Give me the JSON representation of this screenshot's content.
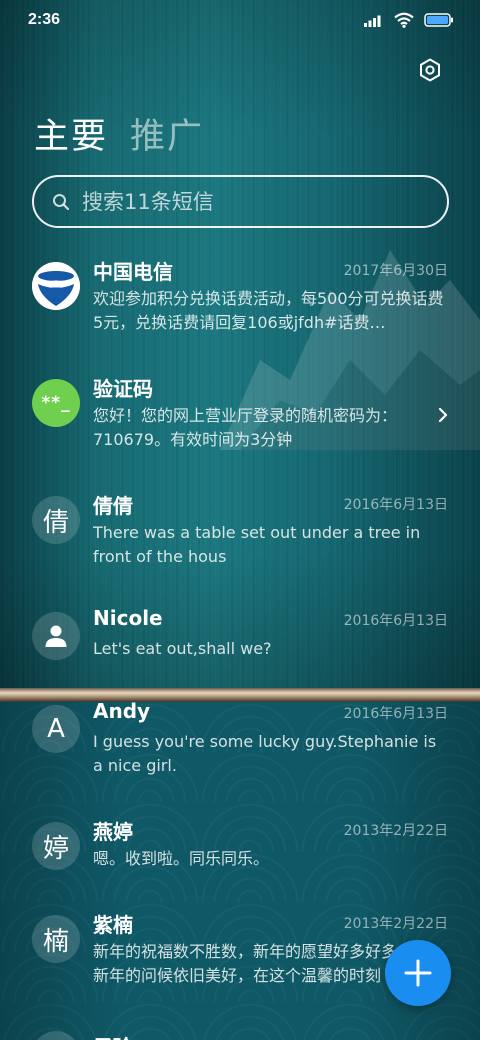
{
  "status_bar": {
    "time": "2:36"
  },
  "tabs": [
    {
      "label": "主要",
      "active": true
    },
    {
      "label": "推广",
      "active": false
    }
  ],
  "search": {
    "placeholder": "搜索11条短信"
  },
  "messages": [
    {
      "name": "中国电信",
      "date": "2017年6月30日",
      "preview": "欢迎参加积分兑换话费活动，每500分可兑换话费5元，兑换话费请回复106或jfdh#话费…",
      "avatar_type": "telecom-logo"
    },
    {
      "name": "验证码",
      "date": "",
      "preview": "您好！您的网上营业厅登录的随机密码为：710679。有效时间为3分钟",
      "avatar_type": "code",
      "avatar_text": "**_"
    },
    {
      "name": "倩倩",
      "date": "2016年6月13日",
      "preview": "There was a table set out under a tree in front of the hous",
      "avatar_type": "letter",
      "avatar_text": "倩"
    },
    {
      "name": "Nicole",
      "date": "2016年6月13日",
      "preview": "Let's eat out,shall we?",
      "avatar_type": "person-icon"
    },
    {
      "name": "Andy",
      "date": "2016年6月13日",
      "preview": "I guess you're some lucky guy.Stephanie is a nice girl.",
      "avatar_type": "letter",
      "avatar_text": "A"
    },
    {
      "name": "燕婷",
      "date": "2013年2月22日",
      "preview": "嗯。收到啦。同乐同乐。",
      "avatar_type": "letter",
      "avatar_text": "婷"
    },
    {
      "name": "紫楠",
      "date": "2013年2月22日",
      "preview": "新年的祝福数不胜数，新年的愿望好多好多，新年的问候依旧美好，在这个温馨的时刻",
      "avatar_type": "letter",
      "avatar_text": "楠"
    },
    {
      "name": "子玲",
      "date": "",
      "preview": "",
      "avatar_type": "letter",
      "avatar_text": ""
    }
  ],
  "colors": {
    "accent": "#1a8ef0",
    "code_avatar": "#6fcf4e",
    "telecom_blue": "#1659a8"
  },
  "icons": {
    "status": [
      "signal-icon",
      "wifi-icon",
      "battery-icon"
    ],
    "settings": "gear-icon",
    "search": "search-icon",
    "fab": "plus-icon",
    "chevron": "chevron-right-icon"
  }
}
